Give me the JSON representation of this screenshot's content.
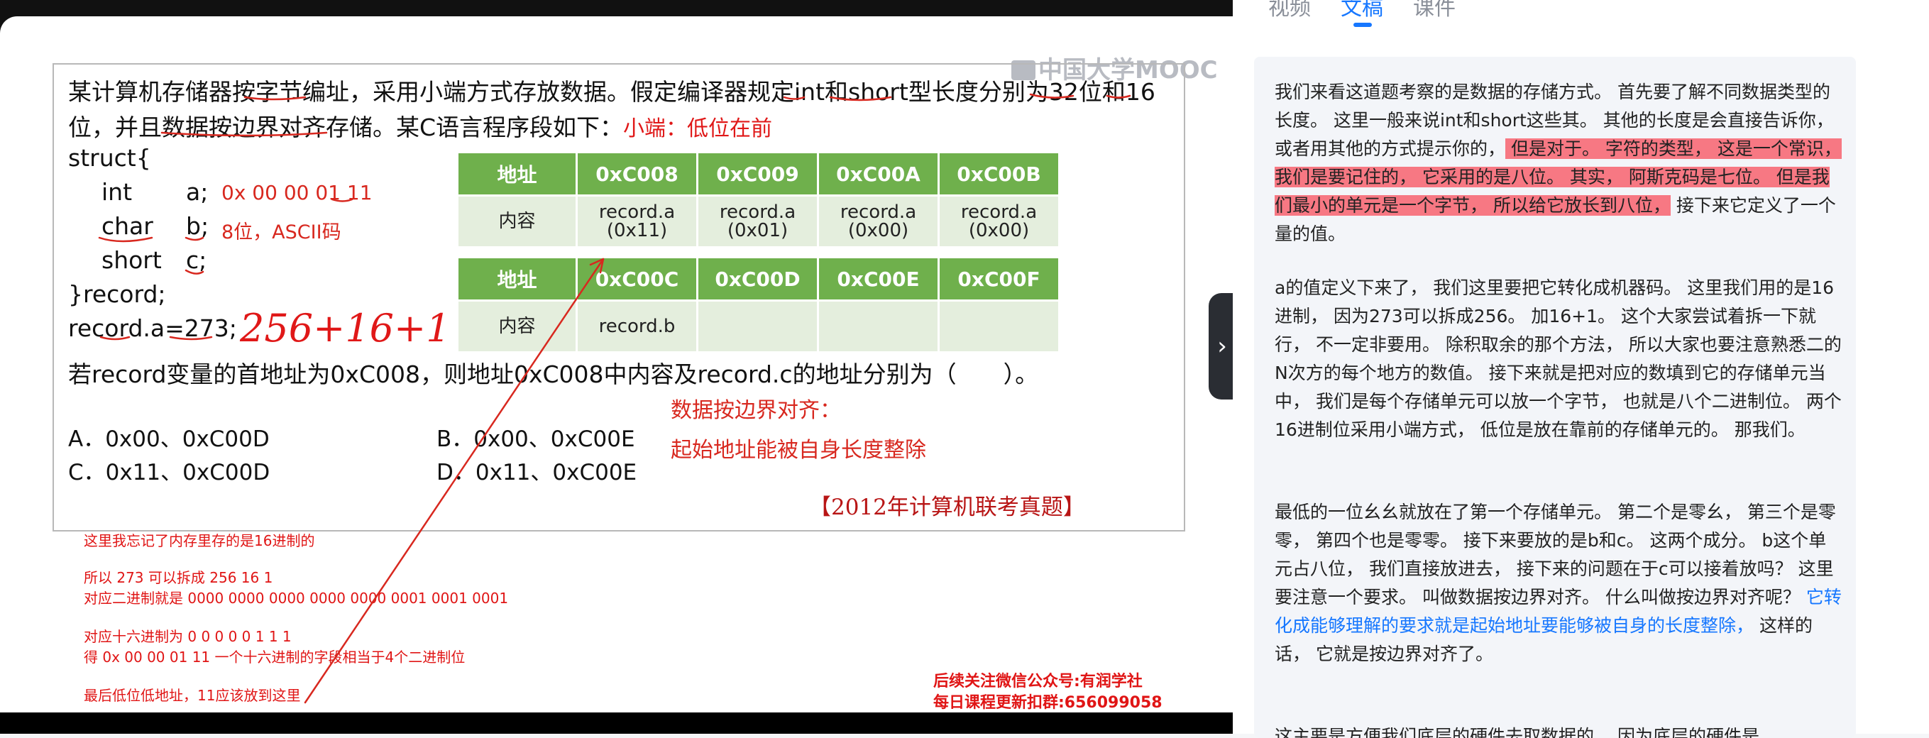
{
  "slide": {
    "watermark": "中国大学MOOC",
    "question_line1": "某计算机存储器按字节编址，采用小端方式存放数据。假定编译器规定int和short型长度分别为32位和16",
    "question_line2": "位，并且数据按边界对齐存储。某C语言程序段如下：",
    "annot_little_endian": "小端：低位在前",
    "code": [
      "struct{",
      "int",
      "a;",
      "char",
      "b;",
      "short",
      "c;",
      "}record;",
      "record.a=273;"
    ],
    "annot_a": "0x 00 00 01 11",
    "annot_b": "8位，ASCII码",
    "annot_sum": "256+16+1",
    "table1": {
      "header": [
        "地址",
        "0xC008",
        "0xC009",
        "0xC00A",
        "0xC00B"
      ],
      "row_label": "内容",
      "cells": [
        [
          "record.a",
          "(0x11)"
        ],
        [
          "record.a",
          "(0x01)"
        ],
        [
          "record.a",
          "(0x00)"
        ],
        [
          "record.a",
          "(0x00)"
        ]
      ]
    },
    "table2": {
      "header": [
        "地址",
        "0xC00C",
        "0xC00D",
        "0xC00E",
        "0xC00F"
      ],
      "row_label": "内容",
      "cells": [
        "record.b",
        "",
        "",
        ""
      ]
    },
    "question_line3": "若record变量的首地址为0xC008，则地址0xC008中内容及record.c的地址分别为（　　）。",
    "align_note1": "数据按边界对齐：",
    "align_note2": "起始地址能被自身长度整除",
    "options": {
      "a": "A．0x00、0xC00D",
      "b": "B．0x00、0xC00E",
      "c": "C．0x11、0xC00D",
      "d": "D．0x11、0xC00E"
    },
    "source": "【2012年计算机联考真题】",
    "notes": [
      "这里我忘记了内存里存的是16进制的",
      "所以 273 可以拆成 256 16 1",
      "对应二进制就是  0000 0000 0000 0000 0000 0001 0001 0001",
      "对应十六进制为    0       0        0        0        0       1       1       1",
      "得 0x 00 00 01 11 一个十六进制的字段相当于4个二进制位",
      "最后低位低地址，11应该放到这里"
    ],
    "promo1": "后续关注微信公众号:有润学社",
    "promo2": "每日课程更新扣群:656099058"
  },
  "panel": {
    "tabs": [
      "视频",
      "文稿",
      "课件"
    ],
    "active_tab": "文稿",
    "p1_a": "我们来看这道题考察的是数据的存储方式。 首先要了解不同数据类型的长度。 这里一般来说int和short这些其。 其他的长度是会直接告诉你， 或者用其他的方式提示你的，",
    "p1_hl": " 但是对于。 字符的类型， 这是一个常识， 我们是要记住的， 它采用的是八位。 其实， 阿斯克码是七位。 但是我们最小的单元是一个字节， 所以给它放长到八位，",
    "p1_b": " 接下来它定义了一个量的值。",
    "p2": "a的值定义下来了， 我们这里要把它转化成机器码。 这里我们用的是16进制， 因为273可以拆成256。 加16+1。 这个大家尝试着拆一下就行， 不一定非要用。 除积取余的那个方法， 所以大家也要注意熟悉二的N次方的每个地方的数值。 接下来就是把对应的数填到它的存储单元当中， 我们是每个存储单元可以放一个字节， 也就是八个二进制位。 两个16进制位采用小端方式， 低位是放在靠前的存储单元的。 那我们。",
    "p3_a": "最低的一位幺幺就放在了第一个存储单元。 第二个是零幺， 第三个是零零， 第四个也是零零。 接下来要放的是b和c。 这两个成分。 b这个单元占八位， 我们直接放进去， 接下来的问题在于c可以接着放吗？ 这里要注意一个要求。 叫做数据按边界对齐。 什么叫做按边界对齐呢？",
    "p3_blue": " 它转化成能够理解的要求就是起始地址要能够被自身的长度整除，",
    "p3_b": " 这样的话， 它就是按边界对齐了。",
    "p4": "这主要是方便我们底层的硬件去取数据的， 因为底层的硬件是"
  }
}
